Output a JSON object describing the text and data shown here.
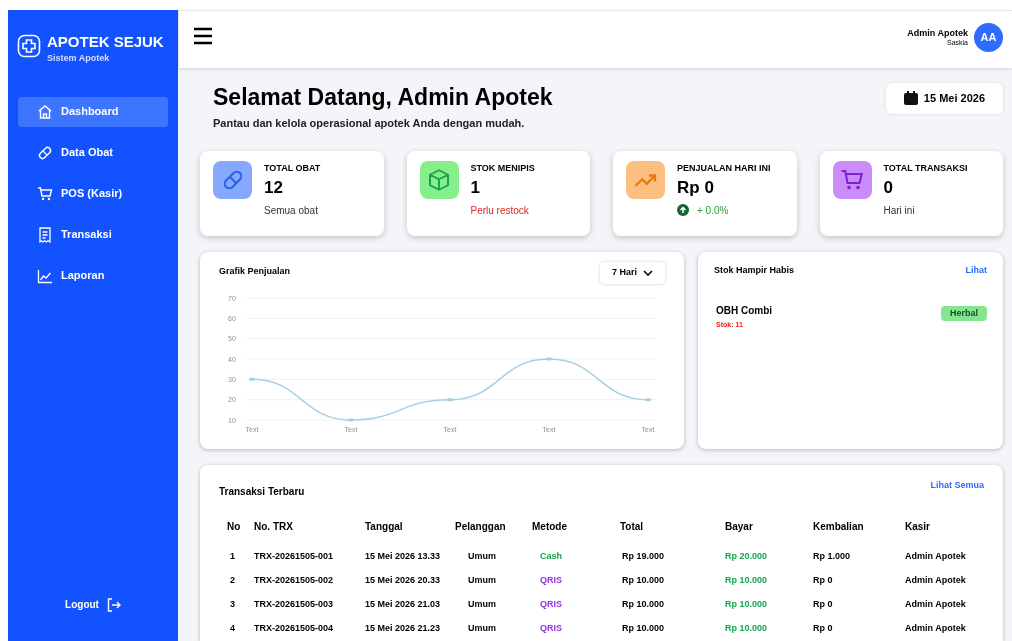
{
  "brand": {
    "title": "APOTEK SEJUK",
    "subtitle": "Sistem Apotek"
  },
  "sidebar": {
    "items": [
      {
        "label": "Dashboard",
        "selected": true
      },
      {
        "label": "Data Obat",
        "selected": false
      },
      {
        "label": "POS (Kasir)",
        "selected": false
      },
      {
        "label": "Transaksi",
        "selected": false
      },
      {
        "label": "Laporan",
        "selected": false
      }
    ],
    "logout": "Logout"
  },
  "user": {
    "name": "Admin Apotek",
    "role": "Saskia",
    "initials": "AA"
  },
  "header": {
    "title": "Selamat Datang, Admin Apotek",
    "subtitle": "Pantau dan kelola operasional apotek Anda dengan mudah.",
    "date": "15 Mei 2026"
  },
  "stats": [
    {
      "label": "TOTAL OBAT",
      "value": "12",
      "note": "Semua obat",
      "kind": "plain",
      "color": "#86a9ff"
    },
    {
      "label": "STOK MENIPIS",
      "value": "1",
      "note": "Perlu restock",
      "kind": "alert",
      "color": "#86ef8c"
    },
    {
      "label": "PENJUALAN HARI INI",
      "value": "Rp 0",
      "note": "+ 0.0%",
      "kind": "trend",
      "color": "#fdbe82"
    },
    {
      "label": "TOTAL TRANSAKSI",
      "value": "0",
      "note": "Hari ini",
      "kind": "plain",
      "color": "#c98cf8"
    }
  ],
  "sales_chart": {
    "title": "Grafik Penjualan",
    "range": "7 Hari",
    "chart_data": {
      "type": "line",
      "categories": [
        "Text",
        "Text",
        "Text",
        "Text",
        "Text"
      ],
      "series": [
        {
          "color": "#a8cfe6",
          "marker": true,
          "values": [
            30,
            10,
            20,
            40,
            20
          ]
        }
      ],
      "grid": true,
      "ylim": [
        10,
        70
      ],
      "yticks": [
        10,
        20,
        30,
        40,
        50,
        60,
        70
      ]
    }
  },
  "low_stock": {
    "title": "Stok Hampir Habis",
    "link": "Lihat",
    "items": [
      {
        "name": "OBH Combi",
        "stock": "Stok: 11",
        "tag": "Herbal"
      }
    ]
  },
  "transactions": {
    "title": "Transaksi Terbaru",
    "link": "Lihat Semua",
    "columns": [
      "No",
      "No. TRX",
      "Tanggal",
      "Pelanggan",
      "Metode",
      "Total",
      "Bayar",
      "Kembalian",
      "Kasir"
    ],
    "rows": [
      {
        "no": "1",
        "trx": "TRX-20261505-001",
        "date": "15 Mei 2026 13.33",
        "customer": "Umum",
        "method": "Cash",
        "color": "#16a34a",
        "total": "Rp 19.000",
        "paid": "Rp 20.000",
        "change": "Rp 1.000",
        "cashier": "Admin Apotek"
      },
      {
        "no": "2",
        "trx": "TRX-20261505-002",
        "date": "15 Mei 2026 20.33",
        "customer": "Umum",
        "method": "QRIS",
        "color": "#9333ea",
        "total": "Rp 10.000",
        "paid": "Rp 10.000",
        "change": "Rp 0",
        "cashier": "Admin Apotek"
      },
      {
        "no": "3",
        "trx": "TRX-20261505-003",
        "date": "15 Mei 2026 21.03",
        "customer": "Umum",
        "method": "QRIS",
        "color": "#9333ea",
        "total": "Rp 10.000",
        "paid": "Rp 10.000",
        "change": "Rp 0",
        "cashier": "Admin Apotek"
      },
      {
        "no": "4",
        "trx": "TRX-20261505-004",
        "date": "15 Mei 2026 21.23",
        "customer": "Umum",
        "method": "QRIS",
        "color": "#9333ea",
        "total": "Rp 10.000",
        "paid": "Rp 10.000",
        "change": "Rp 0",
        "cashier": "Admin Apotek"
      }
    ]
  }
}
